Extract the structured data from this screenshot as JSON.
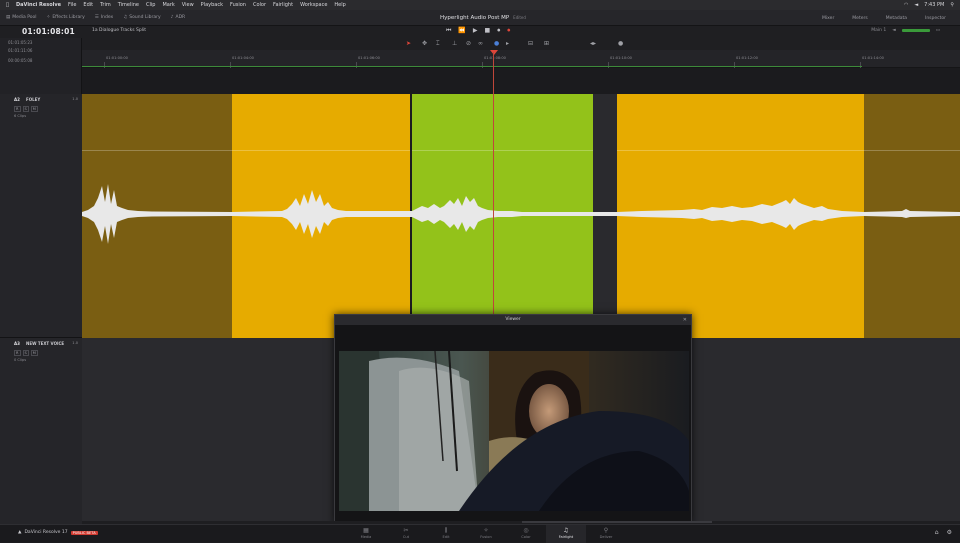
{
  "menubar": {
    "app": "DaVinci Resolve",
    "items": [
      "File",
      "Edit",
      "Trim",
      "Timeline",
      "Clip",
      "Mark",
      "View",
      "Playback",
      "Fusion",
      "Color",
      "Fairlight",
      "Workspace",
      "Help"
    ],
    "clock": "7:43 PM"
  },
  "toolbar": {
    "items": [
      {
        "icon": "media-pool-icon",
        "label": "Media Pool"
      },
      {
        "icon": "effects-library-icon",
        "label": "Effects Library"
      },
      {
        "icon": "index-icon",
        "label": "Index"
      },
      {
        "icon": "sound-library-icon",
        "label": "Sound Library"
      },
      {
        "icon": "adr-icon",
        "label": "ADR"
      }
    ],
    "project_title": "Hyperlight Audio Post MP",
    "edited": "Edited",
    "right_items": [
      "Mixer",
      "Meters",
      "Metadata",
      "Inspector"
    ]
  },
  "timecode": {
    "current": "01:01:08:01",
    "timeline_name": "1a Dialogue Tracks Split",
    "rows": [
      "01:01:05:23",
      "01:01:11:06",
      "00:00:05:08"
    ]
  },
  "transport": {
    "buttons": [
      "⏮",
      "⏪",
      "▶",
      "■",
      "⏺",
      "⏺"
    ]
  },
  "tc_right": {
    "label": "Main 1",
    "level": "0dB"
  },
  "ruler": {
    "marks": [
      {
        "label": "01:01:00:00"
      },
      {
        "label": "01:01:04:00"
      },
      {
        "label": "01:01:06:00"
      },
      {
        "label": "01:01:08:00"
      },
      {
        "label": "01:01:10:00"
      },
      {
        "label": "01:01:12:00"
      },
      {
        "label": "01:01:14:00"
      }
    ]
  },
  "tracks": [
    {
      "num": "A2",
      "name": "FOLEY",
      "channels": "1.0",
      "clips": "6 Clips",
      "buttons": [
        "R",
        "S",
        "M"
      ]
    },
    {
      "num": "A3",
      "name": "NEW TEXT VOICE",
      "channels": "1.0",
      "clips": "0 Clips",
      "buttons": [
        "R",
        "S",
        "M"
      ]
    }
  ],
  "clips": {
    "colors": {
      "orange": "#e6ab00",
      "orange_dim": "#7a5e12",
      "green": "#93c21a",
      "bg": "#2a2a2e"
    }
  },
  "viewer": {
    "title": "Viewer"
  },
  "pagebar": {
    "brand": "DaVinci Resolve 17",
    "badge": "PUBLIC BETA",
    "pages": [
      {
        "icon": "media-page-icon",
        "glyph": "▦",
        "label": "Media"
      },
      {
        "icon": "cut-page-icon",
        "glyph": "✂",
        "label": "Cut"
      },
      {
        "icon": "edit-page-icon",
        "glyph": "⫼",
        "label": "Edit"
      },
      {
        "icon": "fusion-page-icon",
        "glyph": "✧",
        "label": "Fusion"
      },
      {
        "icon": "color-page-icon",
        "glyph": "◎",
        "label": "Color"
      },
      {
        "icon": "fairlight-page-icon",
        "glyph": "♫",
        "label": "Fairlight"
      },
      {
        "icon": "deliver-page-icon",
        "glyph": "⚲",
        "label": "Deliver"
      }
    ],
    "active_page": "Fairlight"
  }
}
